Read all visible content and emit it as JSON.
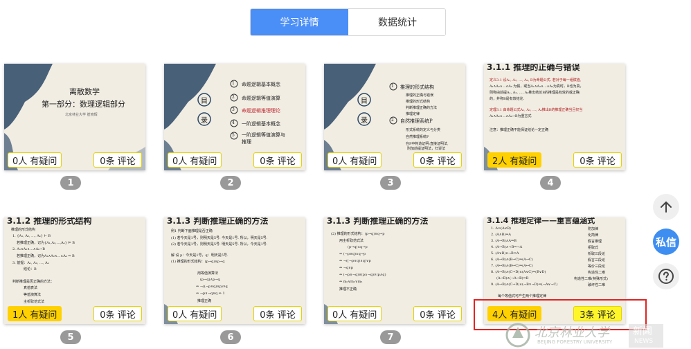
{
  "tabs": [
    {
      "label": "学习详情",
      "active": true
    },
    {
      "label": "数据统计",
      "active": false
    }
  ],
  "slides": [
    {
      "page": "1",
      "questions": "0人 有疑问",
      "comments": "0条 评论",
      "lines": [
        "离散数学",
        "第一部分：数理逻辑部分",
        "北京林业大学 崔晓辉"
      ]
    },
    {
      "page": "2",
      "questions": "0人 有疑问",
      "comments": "0条 评论",
      "menu_title": "目",
      "menu_title2": "录",
      "lines": [
        "命题逻辑基本概念",
        "命题逻辑等值演算",
        "命题逻辑推理理论",
        "一阶逻辑基本概念",
        "一阶逻辑等值演算与",
        "推理"
      ],
      "nums": [
        "1",
        "2",
        "3",
        "4",
        "5"
      ]
    },
    {
      "page": "3",
      "questions": "0人 有疑问",
      "comments": "0条 评论",
      "menu_title": "目",
      "menu_title2": "录",
      "lines": [
        "推理的形式结构",
        "推理的正确与错误",
        "推理的形式结构",
        "判断推理正确的方法",
        "推理定律",
        "自然推理系统P",
        "形式系统的定义与分类",
        "自然推理系统P",
        "在P中构造证明:直接证明法,",
        "附加前提证明法，归谬法"
      ],
      "nums": [
        "1",
        "2"
      ]
    },
    {
      "page": "4",
      "questions": "2人 有疑问",
      "comments": "0条 评论",
      "lines": [
        "3.1.1 推理的正确与错误",
        "定义3.1 设A₁, A₂, …, Aₖ, B为命题公式. 若对于每一组赋值,",
        "A₁∧A₂∧…∧Aₖ 为假，或当A₁∧A₂∧…∧Aₖ为真时，B也为真，",
        "则称由前提A₁, A₂, …, Aₖ推出结论B的推理是有效的或正确",
        "的，并称B是有效结论.",
        "定理3.1 由命题公式A₁, A₂, …, Aₖ推出B的推理正确当且仅当",
        "A₁∧A₂∧…∧Aₖ→B为重言式",
        "注意：推理正确不能保证结论一定正确"
      ]
    },
    {
      "page": "5",
      "questions": "1人 有疑问",
      "comments": "0条 评论",
      "lines": [
        "3.1.2 推理的形式结构",
        "推理的形式结构",
        "1. {A₁, A₂, …, Aₖ} ⊢ B",
        "若推理正确，记为{A₁,A₂,…,Aₖ} ⊨ B",
        "2. A₁∧A₂∧…∧Aₖ→B",
        "若推理正确，记为A₁∧A₂∧…∧Aₖ ⇒ B",
        "3. 前提：A₁, A₂, …, Aₖ",
        "结论：B",
        "判断推理是否正确的方法：",
        "真值表法",
        "等值演算法",
        "主析取范式法"
      ]
    },
    {
      "page": "6",
      "questions": "0人 有疑问",
      "comments": "0条 评论",
      "lines": [
        "3.1.3 判断推理正确的方法",
        "例1 判断下面推理是否正确",
        "(1) 若今天是1号，则明天是5号. 今天是1号. 所以，明天是5号.",
        "(2) 若今天是1号，则明天是5号. 明天是5号. 所以，今天是1号.",
        "解 设 p：今天是1号，q：明天是5号.",
        "(1) 推理的形式结构：(p→q)∧p→q",
        "用等值演算法",
        "(p→q)∧p→q",
        "⇔ ¬((¬p∨q)∧p)∨q",
        "⇔ ¬p∨¬q∨q ⇔ 1",
        "推理正确"
      ]
    },
    {
      "page": "7",
      "questions": "0人 有疑问",
      "comments": "0条 评论",
      "lines": [
        "3.1.3 判断推理正确的方法",
        "(2) 推理的形式结构：(p→q)∧q→p",
        "用主析取范式法",
        "(p→q)∧q→p",
        "⇔ (¬p∨q)∧q→p",
        "⇔ ¬((¬p∨q)∧q)∨p",
        "⇔ ¬q∨p",
        "⇔ (¬p∧¬q)∨(p∧¬q)∨(p∧q)",
        "⇔ m₀∨m₂∨m₃",
        "推理不正确"
      ]
    },
    {
      "page": "8",
      "questions": "4人 有疑问",
      "comments": "3条 评论",
      "lines": [
        "3.1.4 推理定律——重言蕴涵式",
        "1. A⇒(A∨B)",
        "2. (A∧B)⇒A",
        "3. (A→B)∧A⇒B",
        "4. (A→B)∧¬B⇒¬A",
        "5. (A∨B)∧¬B⇒A",
        "6. (A→B)∧(B→C)⇒(A→C)",
        "7. (A↔B)∧(B↔C)⇒(A↔C)",
        "8. (A→B)∧(C→D)∧(A∨C)⇒(B∨D)",
        "(A→B)∧(¬A→B)⇒B",
        "9. (A→B)∧(C→D)∧(¬B∨¬D)⇒(¬A∨¬C)",
        "每个等值式可产生两个推理定律"
      ],
      "rules": [
        "附加律",
        "化简律",
        "假言推理",
        "拒取式",
        "析取三段论",
        "假言三段论",
        "等价三段论",
        "构造性二难",
        "构造性二难(特殊形式)",
        "破坏性二难"
      ]
    }
  ],
  "floating": {
    "top_label": "↑",
    "message_label": "私信",
    "help_label": "?"
  },
  "watermark": {
    "text": "北京林业大学",
    "sub": "BEIJING FORESTRY UNIVERSITY",
    "news": "新闻",
    "news_en": "NEWS"
  },
  "colors": {
    "accent": "#4a8ef8",
    "highlight": "#ffd100",
    "highlight_comments": "#fff62a",
    "red_box": "#e12222",
    "page_badge": "#999999"
  }
}
